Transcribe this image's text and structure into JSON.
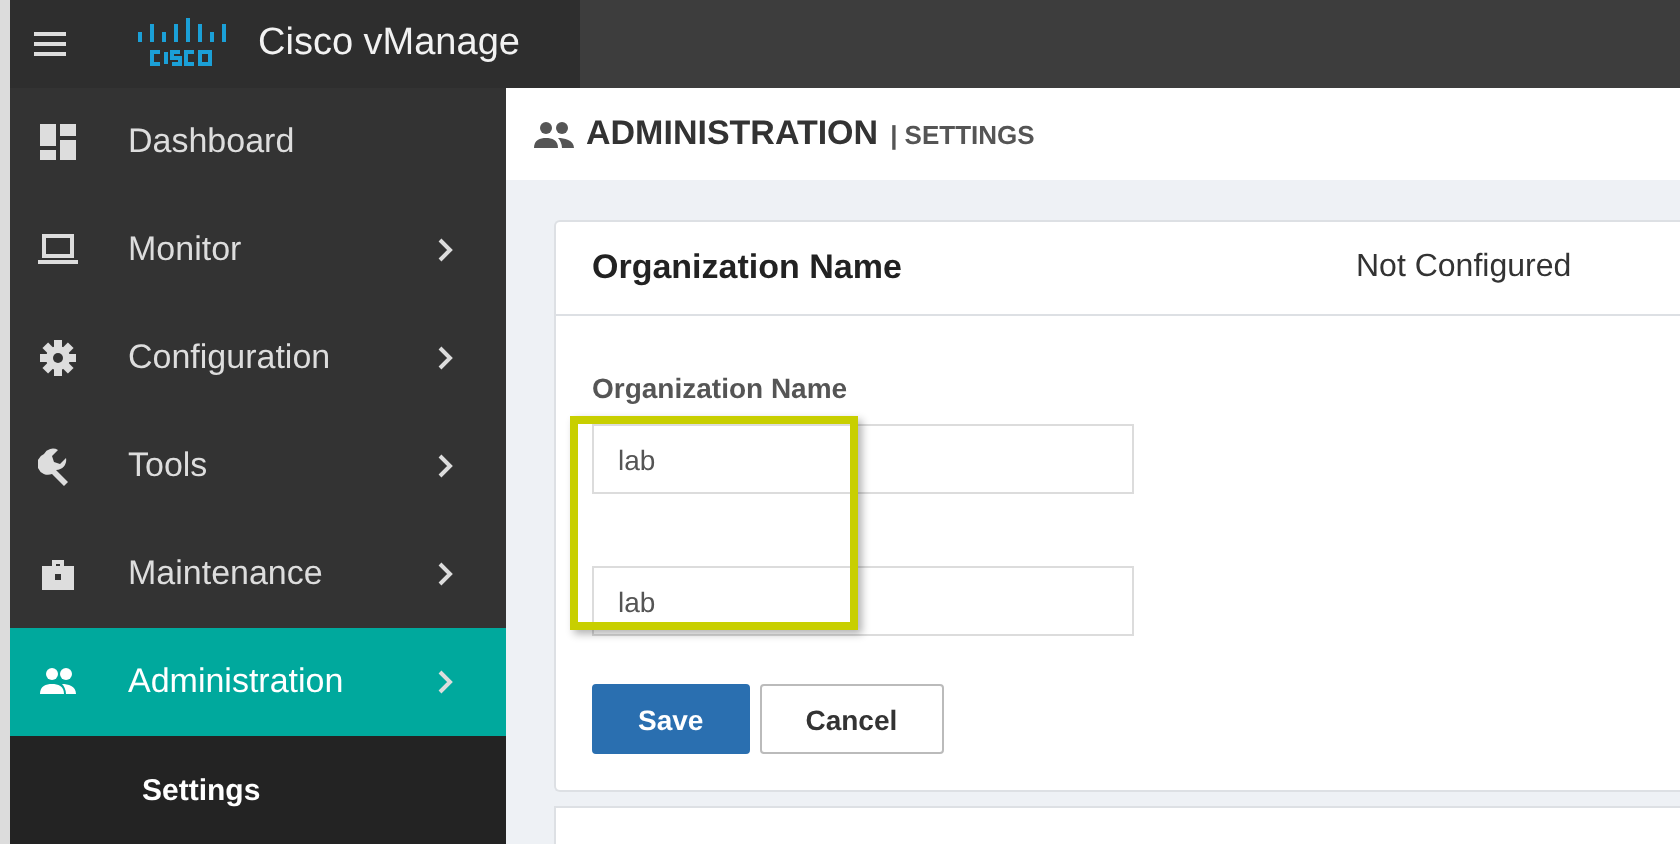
{
  "topbar": {
    "brand": "Cisco vManage"
  },
  "sidebar": {
    "items": [
      {
        "label": "Dashboard",
        "selected": false,
        "submenu": false
      },
      {
        "label": "Monitor",
        "selected": false,
        "submenu": true
      },
      {
        "label": "Configuration",
        "selected": false,
        "submenu": true
      },
      {
        "label": "Tools",
        "selected": false,
        "submenu": true
      },
      {
        "label": "Maintenance",
        "selected": false,
        "submenu": true
      },
      {
        "label": "Administration",
        "selected": true,
        "submenu": true,
        "children": [
          {
            "label": "Settings",
            "selected": true
          }
        ]
      }
    ]
  },
  "page_header": {
    "title": "ADMINISTRATION",
    "subtitle": "| SETTINGS"
  },
  "card": {
    "title": "Organization Name",
    "status": "Not Configured",
    "field_label": "Organization Name",
    "fields": [
      {
        "value": "lab"
      },
      {
        "value": "lab"
      }
    ],
    "highlighted": true,
    "buttons": [
      {
        "label": "Save",
        "kind": "primary"
      },
      {
        "label": "Cancel",
        "kind": "secondary"
      }
    ]
  }
}
